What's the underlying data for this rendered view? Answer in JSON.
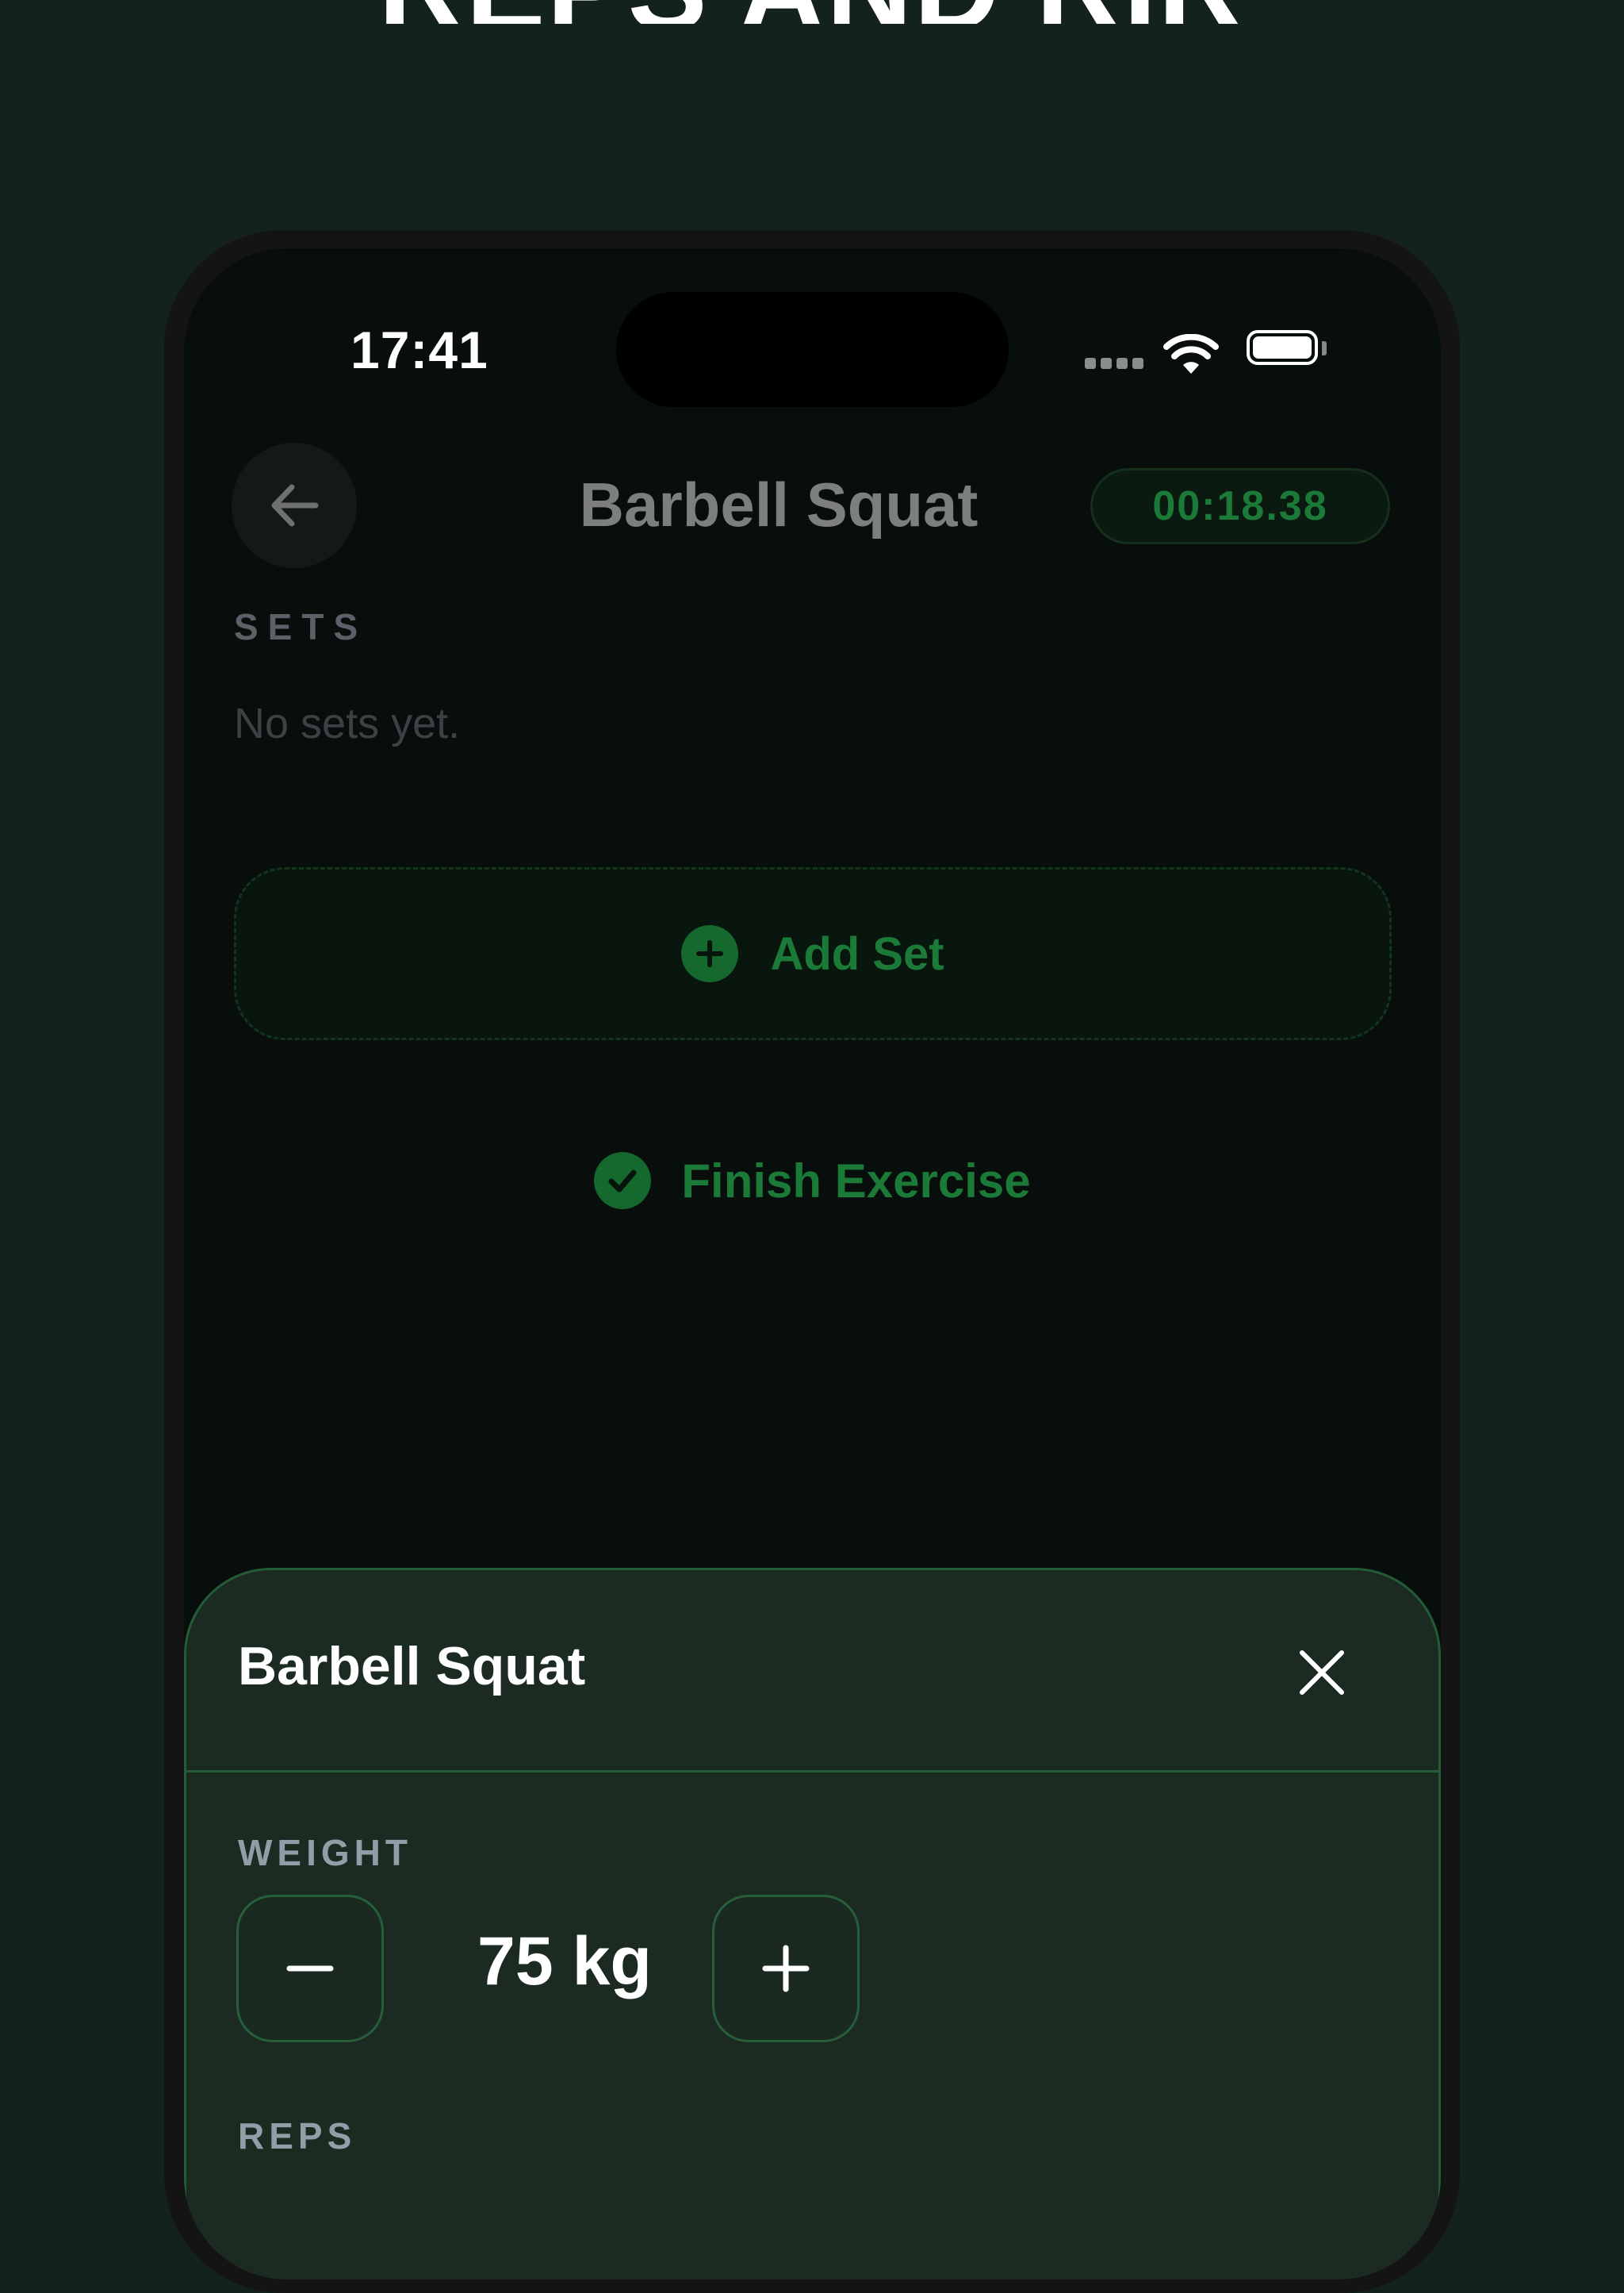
{
  "headline": "REPS AND RIR",
  "status_bar": {
    "time": "17:41"
  },
  "header": {
    "title": "Barbell Squat",
    "timer": "00:18.38"
  },
  "sets": {
    "section_label": "SETS",
    "empty_text": "No sets yet."
  },
  "actions": {
    "add_set_label": "Add Set",
    "finish_label": "Finish Exercise"
  },
  "sheet": {
    "title": "Barbell Squat",
    "weight_label": "WEIGHT",
    "weight_value": "75 kg",
    "reps_label": "REPS"
  },
  "colors": {
    "accent": "#1b7a38",
    "background": "#13221a",
    "sheet": "#1c2b22"
  }
}
